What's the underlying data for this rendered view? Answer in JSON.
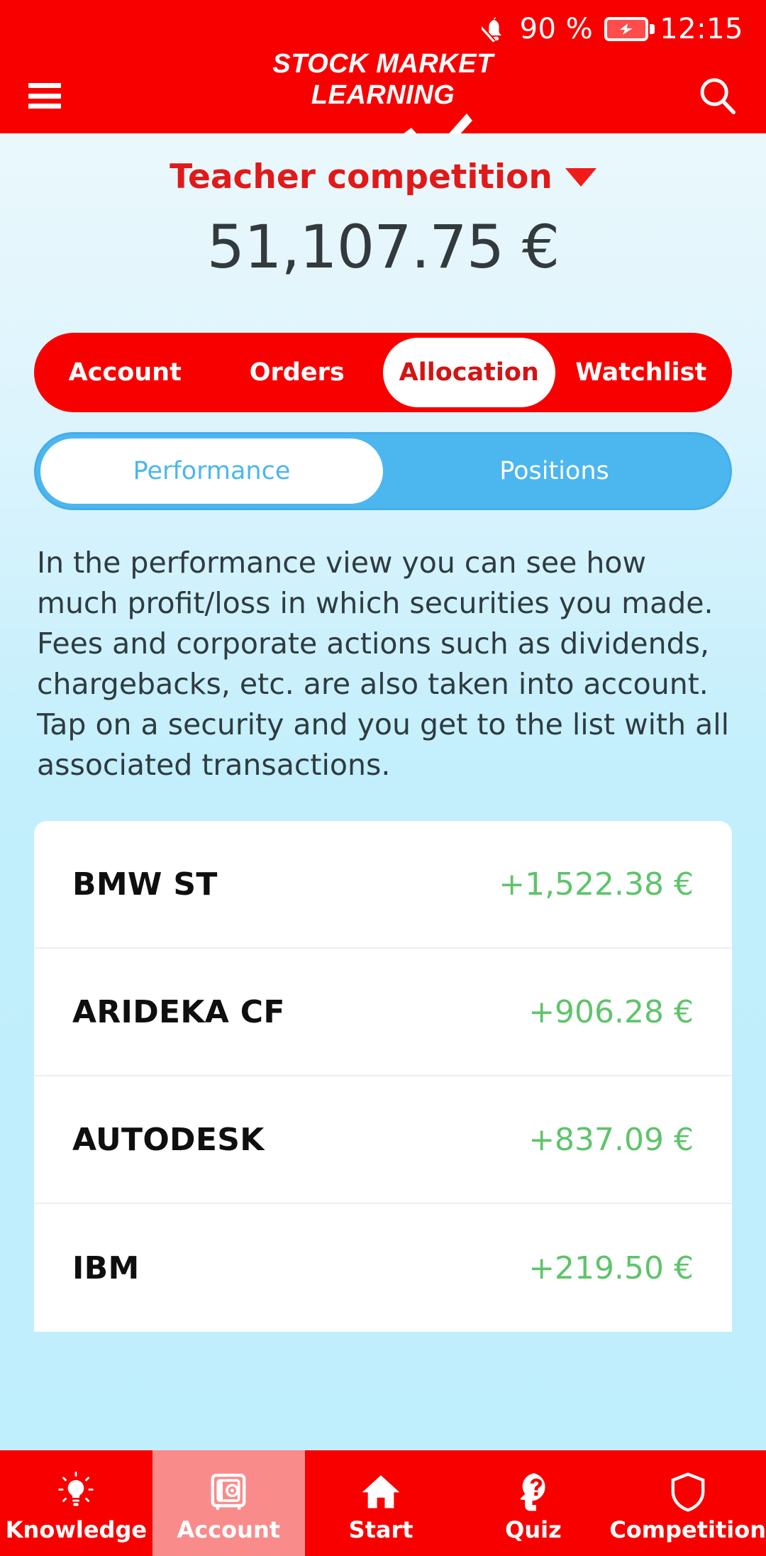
{
  "status_bar": {
    "notification_icon": "bell-off-icon",
    "battery_percent": "90 %",
    "battery_icon": "battery-charging-icon",
    "time": "12:15"
  },
  "header": {
    "menu_icon": "hamburger-menu-icon",
    "brand_line1": "STOCK MARKET",
    "brand_line2": "LEARNING",
    "logo_icon": "zigzag-chart-icon",
    "search_icon": "search-icon"
  },
  "account": {
    "selector_label": "Teacher competition",
    "selector_icon": "caret-down-icon",
    "balance": "51,107.75 €"
  },
  "primary_tabs": {
    "items": [
      {
        "label": "Account",
        "active": false
      },
      {
        "label": "Orders",
        "active": false
      },
      {
        "label": "Allocation",
        "active": true
      },
      {
        "label": "Watchlist",
        "active": false
      }
    ]
  },
  "secondary_tabs": {
    "items": [
      {
        "label": "Performance",
        "active": true
      },
      {
        "label": "Positions",
        "active": false
      }
    ]
  },
  "description": "In the performance view you can see how much profit/loss in which securities you made. Fees and corporate actions such as dividends, chargebacks, etc. are also taken into account. Tap on a security and you get to the list with all associated transactions.",
  "securities": [
    {
      "name": "BMW ST",
      "value": "+1,522.38 €"
    },
    {
      "name": "ARIDEKA CF",
      "value": "+906.28 €"
    },
    {
      "name": "AUTODESK",
      "value": "+837.09 €"
    },
    {
      "name": "IBM",
      "value": "+219.50 €"
    }
  ],
  "bottom_nav": {
    "items": [
      {
        "label": "Knowledge",
        "icon": "lightbulb-icon",
        "active": false
      },
      {
        "label": "Account",
        "icon": "safe-vault-icon",
        "active": true
      },
      {
        "label": "Start",
        "icon": "home-icon",
        "active": false
      },
      {
        "label": "Quiz",
        "icon": "head-question-icon",
        "active": false
      },
      {
        "label": "Competition",
        "icon": "shield-icon",
        "active": false
      }
    ]
  },
  "colors": {
    "brand_red": "#f90000",
    "accent_blue": "#4cb6ef",
    "positive_green": "#5ec46a",
    "background_blue": "#c3effc"
  }
}
